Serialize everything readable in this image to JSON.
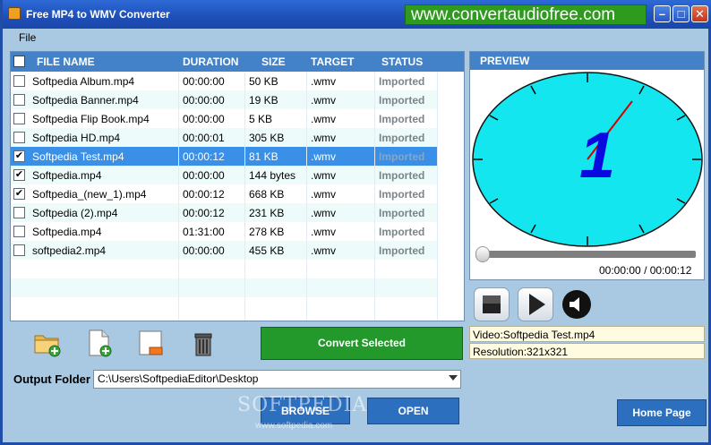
{
  "window": {
    "title": "Free MP4 to WMV Converter",
    "promo": "www.convertaudiofree.com"
  },
  "menu": {
    "file": "File"
  },
  "columns": {
    "file_name": "FILE NAME",
    "duration": "DURATION",
    "size": "SIZE",
    "target": "TARGET",
    "status": "STATUS"
  },
  "rows": [
    {
      "checked": "",
      "name": "Softpedia Album.mp4",
      "duration": "00:00:00",
      "size": "50 KB",
      "target": ".wmv",
      "status": "Imported"
    },
    {
      "checked": "",
      "name": "Softpedia Banner.mp4",
      "duration": "00:00:00",
      "size": "19 KB",
      "target": ".wmv",
      "status": "Imported"
    },
    {
      "checked": "",
      "name": "Softpedia Flip Book.mp4",
      "duration": "00:00:00",
      "size": "5 KB",
      "target": ".wmv",
      "status": "Imported"
    },
    {
      "checked": "",
      "name": "Softpedia HD.mp4",
      "duration": "00:00:01",
      "size": "305 KB",
      "target": ".wmv",
      "status": "Imported"
    },
    {
      "checked": "✔",
      "name": "Softpedia Test.mp4",
      "duration": "00:00:12",
      "size": "81 KB",
      "target": ".wmv",
      "status": "Imported"
    },
    {
      "checked": "✔",
      "name": "Softpedia.mp4",
      "duration": "00:00:00",
      "size": "144 bytes",
      "target": ".wmv",
      "status": "Imported"
    },
    {
      "checked": "✔",
      "name": "Softpedia_(new_1).mp4",
      "duration": "00:00:12",
      "size": "668 KB",
      "target": ".wmv",
      "status": "Imported"
    },
    {
      "checked": "",
      "name": "Softpedia (2).mp4",
      "duration": "00:00:12",
      "size": "231 KB",
      "target": ".wmv",
      "status": "Imported"
    },
    {
      "checked": "",
      "name": "Softpedia.mp4",
      "duration": "01:31:00",
      "size": "278 KB",
      "target": ".wmv",
      "status": "Imported"
    },
    {
      "checked": "",
      "name": "softpedia2.mp4",
      "duration": "00:00:00",
      "size": "455 KB",
      "target": ".wmv",
      "status": "Imported"
    }
  ],
  "selected_row": 4,
  "toolbar": {
    "add_folder_icon": "folder-add-icon",
    "add_file_icon": "file-add-icon",
    "remove_icon": "remove-icon",
    "clear_icon": "trash-icon",
    "convert_label": "Convert Selected"
  },
  "output": {
    "label": "Output Folder",
    "value": "C:\\Users\\SoftpediaEditor\\Desktop",
    "browse_label": "BROWSE",
    "open_label": "OPEN"
  },
  "preview": {
    "title": "PREVIEW",
    "current_time": "00:00:00",
    "separator": "/",
    "total_time": "00:00:12",
    "video_info": "Video:Softpedia Test.mp4",
    "resolution": "Resolution:321x321",
    "frame_digit": "1"
  },
  "home_label": "Home Page",
  "watermark": {
    "main": "SOFTPEDIA",
    "sub": "www.softpedia.com"
  },
  "colors": {
    "header_blue": "#4382c8",
    "selected_row": "#3a8fe6",
    "convert_green": "#23992b",
    "clock_face": "#14e6f0"
  }
}
